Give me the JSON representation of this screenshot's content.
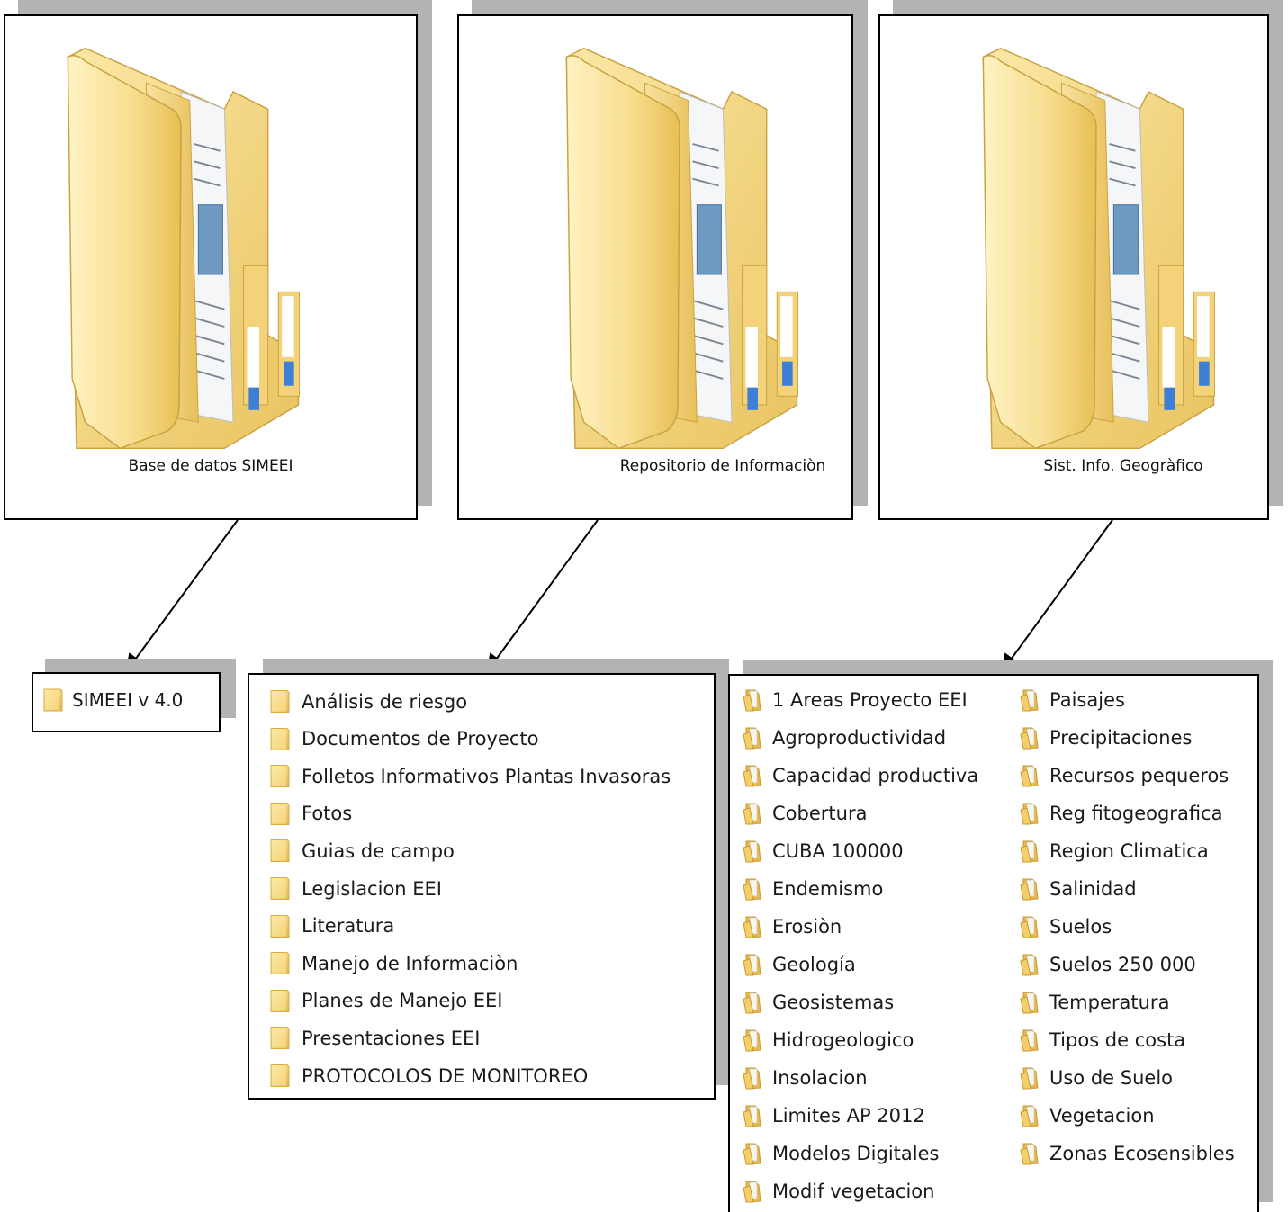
{
  "top_folders": [
    {
      "label": "Base de datos SIMEEI"
    },
    {
      "label": "Repositorio de Informaciòn"
    },
    {
      "label": "Sist. Info. Geogràfico"
    }
  ],
  "simeei_panel": {
    "items": [
      "SIMEEI v 4.0"
    ]
  },
  "repositorio_panel": {
    "items": [
      "Análisis de riesgo",
      "Documentos de Proyecto",
      "Folletos Informativos Plantas Invasoras",
      "Fotos",
      "Guias de campo",
      "Legislacion EEI",
      "Literatura",
      "Manejo de Informaciòn",
      "Planes de Manejo EEI",
      "Presentaciones EEI",
      "PROTOCOLOS DE MONITOREO"
    ]
  },
  "sig_panel": {
    "column1": [
      "1 Areas Proyecto EEI",
      "Agroproductividad",
      "Capacidad productiva",
      "Cobertura",
      "CUBA 100000",
      "Endemismo",
      "Erosiòn",
      "Geología",
      "Geosistemas",
      "Hidrogeologico",
      "Insolacion",
      "Limites AP 2012",
      "Modelos Digitales",
      "Modif vegetacion"
    ],
    "column2": [
      "Paisajes",
      "Precipitaciones",
      "Recursos pequeros",
      "Reg fitogeografica",
      "Region Climatica",
      "Salinidad",
      "Suelos",
      "Suelos 250 000",
      "Temperatura",
      "Tipos de costa",
      "Uso de Suelo",
      "Vegetacion",
      "Zonas Ecosensibles"
    ]
  },
  "colors": {
    "folder_light": "#fbe9a8",
    "folder_mid": "#f2cf6e",
    "folder_dark": "#d9ad42",
    "shadow": "#b3b3b3"
  }
}
